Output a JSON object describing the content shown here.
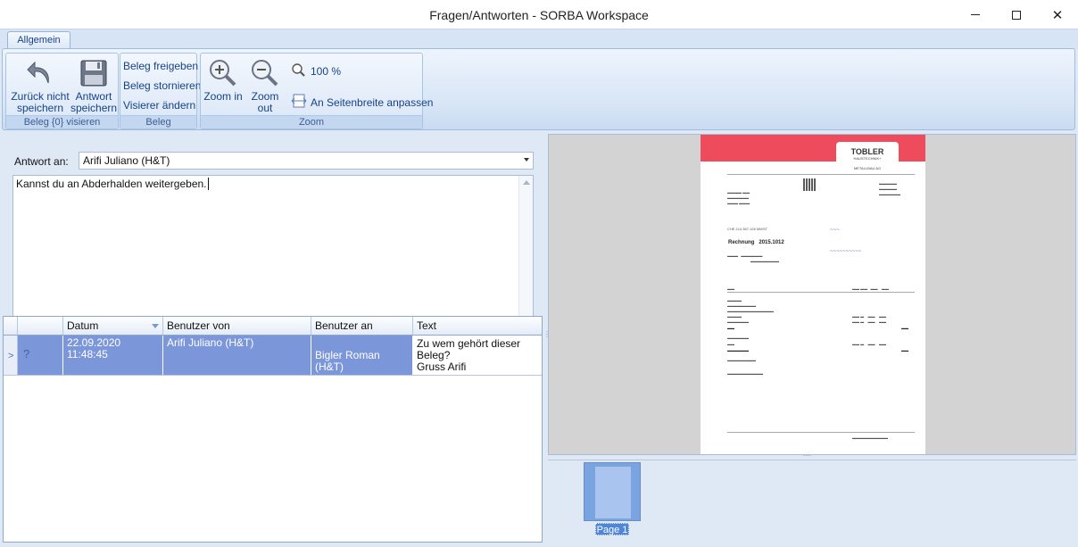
{
  "window": {
    "title": "Fragen/Antworten - SORBA Workspace"
  },
  "ribbon": {
    "tab": "Allgemein",
    "groups": {
      "visieren": {
        "label": "Beleg {0} visieren",
        "back_line1": "Zurück nicht",
        "back_line2": "speichern",
        "save_line1": "Antwort",
        "save_line2": "speichern"
      },
      "beleg": {
        "label": "Beleg",
        "release": "Beleg freigeben",
        "cancel": "Beleg stornieren",
        "change_visa": "Visierer ändern"
      },
      "zoom": {
        "label": "Zoom",
        "zoom_in": "Zoom in",
        "zoom_out": "Zoom out",
        "zoom_level": "100 %",
        "fit_width": "An Seitenbreite anpassen"
      }
    }
  },
  "form": {
    "reply_to_label": "Antwort an:",
    "reply_to_value": "Arifi Juliano (H&T)",
    "message": "Kannst du an Abderhalden weitergeben."
  },
  "grid": {
    "columns": [
      "Datum",
      "Benutzer von",
      "Benutzer an",
      "Text"
    ],
    "rows": [
      {
        "icon": "?",
        "datum": "22.09.2020 11:48:45",
        "von": "Arifi Juliano (H&T)",
        "an": "Bigler Roman (H&T)",
        "text_line1": "Zu wem gehört dieser",
        "text_line2": "Beleg?",
        "text_line3": "Gruss Arifi"
      }
    ]
  },
  "document": {
    "logo_name": "TOBLER",
    "logo_sub1": "HAUSTECHNIK+",
    "logo_sub2": "METALLBAU AG",
    "invoice_label": "Rechnung",
    "invoice_number": "2015.1012",
    "vat_id": "CHE-114.367.128 MWST"
  },
  "thumbnails": {
    "page_label": "Page 1"
  }
}
